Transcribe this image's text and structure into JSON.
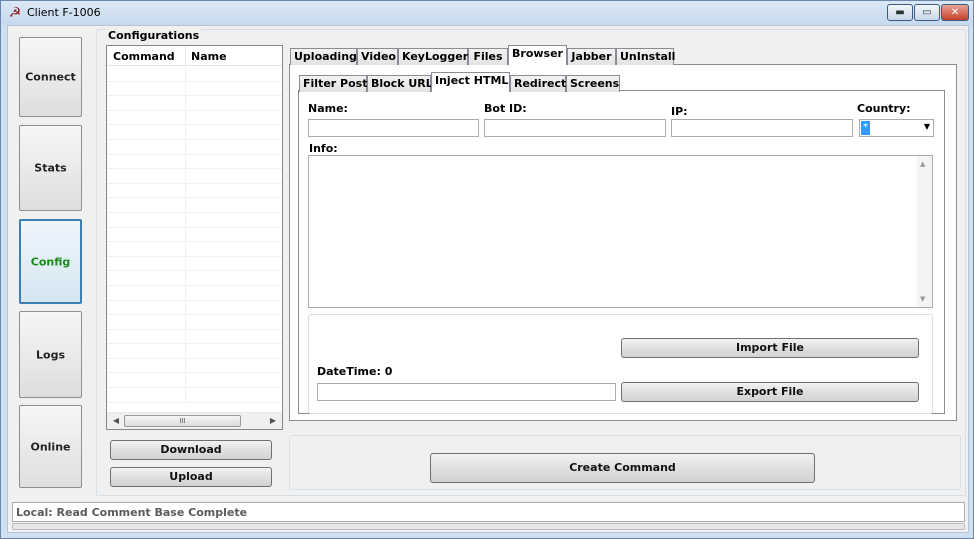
{
  "window": {
    "title": "Client F-1006",
    "minimize": "▬",
    "maximize": "▭",
    "close": "✕"
  },
  "nav": {
    "connect": "Connect",
    "stats": "Stats",
    "config": "Config",
    "logs": "Logs",
    "online": "Online",
    "active": "Config"
  },
  "configurations": {
    "group_label": "Configurations",
    "columns": [
      "Command",
      "Name"
    ],
    "rows": [],
    "scroll_thumb": "III",
    "download_label": "Download",
    "upload_label": "Upload"
  },
  "tabs": {
    "outer": [
      "Uploading",
      "Video",
      "KeyLogger",
      "Files",
      "Browser",
      "Jabber",
      "UnInstall"
    ],
    "outer_active": "Browser",
    "inner": [
      "Filter Post",
      "Block URL",
      "Inject HTML",
      "Redirect",
      "Screens"
    ],
    "inner_active": "Inject HTML"
  },
  "form": {
    "name_label": "Name:",
    "name_value": "",
    "botid_label": "Bot ID:",
    "botid_value": "",
    "ip_label": "IP:",
    "ip_value": "",
    "country_label": "Country:",
    "country_value": "*",
    "info_label": "Info:",
    "info_value": "",
    "import_label": "Import File",
    "datetime_label": "DateTime: 0",
    "datetime_value": "",
    "export_label": "Export File",
    "create_label": "Create Command"
  },
  "status": {
    "text": "Local: Read Comment Base Complete",
    "progress": 0
  },
  "colors": {
    "active_nav_text": "#1a8a1a",
    "active_nav_border": "#3c7fb1",
    "selection": "#3399ff"
  },
  "icons": {
    "app": "hammer-sickle-icon",
    "dropdown": "chevron-down-icon",
    "scroll_left": "chevron-left-icon",
    "scroll_right": "chevron-right-icon"
  }
}
